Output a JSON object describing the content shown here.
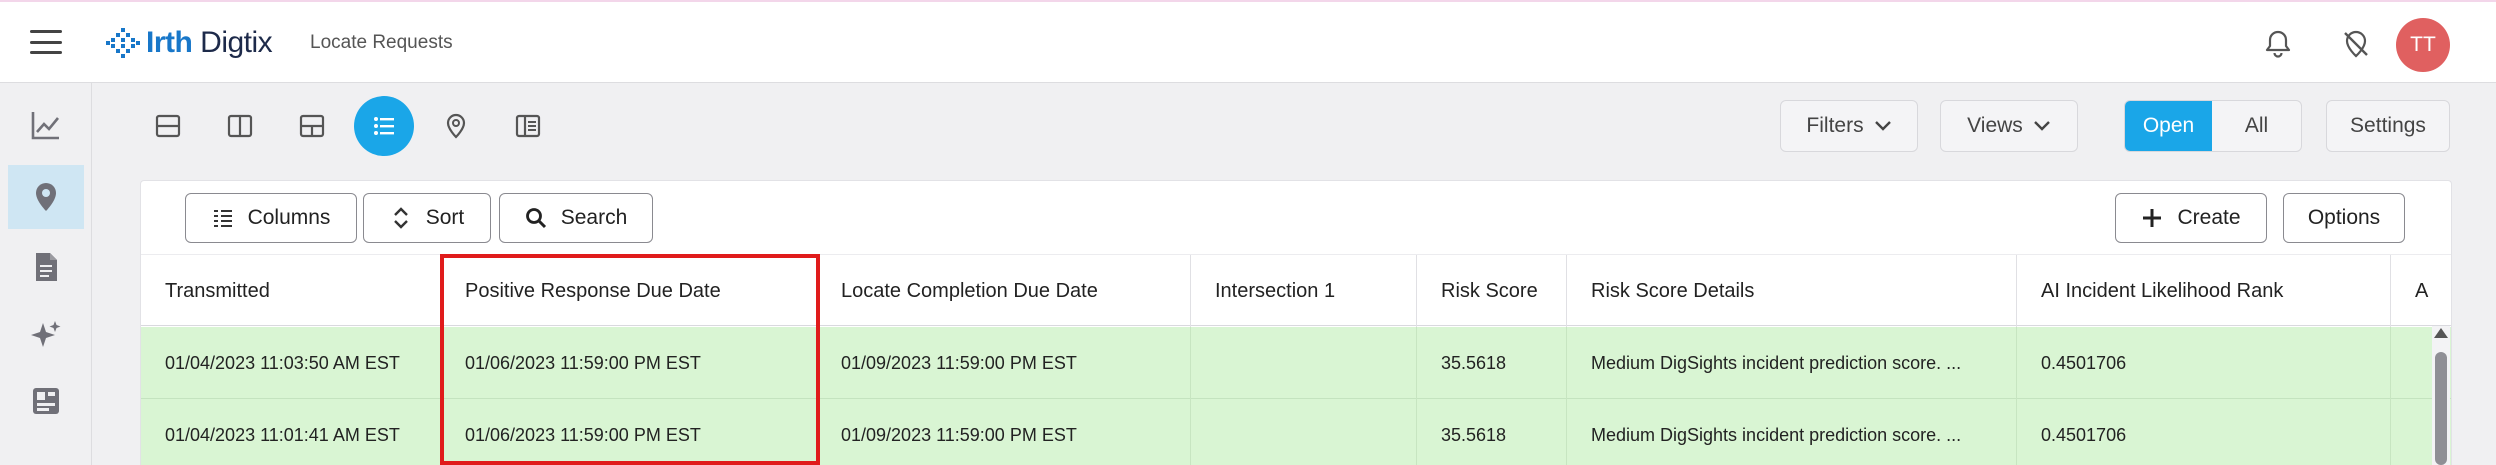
{
  "header": {
    "brand_bold": "Irth",
    "brand_rest": " Digtix",
    "page_title": "Locate Requests",
    "avatar_initials": "TT"
  },
  "sidebar": {
    "items": [
      {
        "icon": "analytics-chart-icon",
        "active": false
      },
      {
        "icon": "map-pin-icon",
        "active": true
      },
      {
        "icon": "document-icon",
        "active": false
      },
      {
        "icon": "sparkle-ai-icon",
        "active": false
      },
      {
        "icon": "dashboard-layout-icon",
        "active": false
      }
    ]
  },
  "view_toolbar": {
    "views": [
      {
        "icon": "split-horizontal-icon",
        "active": false
      },
      {
        "icon": "split-vertical-icon",
        "active": false
      },
      {
        "icon": "grid-layout-icon",
        "active": false
      },
      {
        "icon": "list-icon",
        "active": true
      },
      {
        "icon": "map-pin-outline-icon",
        "active": false
      },
      {
        "icon": "side-panel-icon",
        "active": false
      }
    ],
    "filters_label": "Filters",
    "views_label": "Views",
    "open_label": "Open",
    "all_label": "All",
    "settings_label": "Settings",
    "accent_color": "#1aa6e8"
  },
  "card_toolbar": {
    "columns_label": "Columns",
    "sort_label": "Sort",
    "search_label": "Search",
    "create_label": "Create",
    "options_label": "Options"
  },
  "table": {
    "columns": [
      "Transmitted",
      "Positive Response Due Date",
      "Locate Completion Due Date",
      "Intersection 1",
      "Risk Score",
      "Risk Score Details",
      "AI Incident Likelihood Rank",
      "A"
    ],
    "rows": [
      [
        "01/04/2023 11:03:50 AM EST",
        "01/06/2023 11:59:00 PM EST",
        "01/09/2023 11:59:00 PM EST",
        "",
        "35.5618",
        "Medium DigSights incident prediction score. ...",
        "0.4501706",
        ""
      ],
      [
        "01/04/2023 11:01:41 AM EST",
        "01/06/2023 11:59:00 PM EST",
        "01/09/2023 11:59:00 PM EST",
        "",
        "35.5618",
        "Medium DigSights incident prediction score. ...",
        "0.4501706",
        ""
      ]
    ],
    "row_color": "#d9f5d3",
    "highlight_color": "#e01b1b"
  }
}
